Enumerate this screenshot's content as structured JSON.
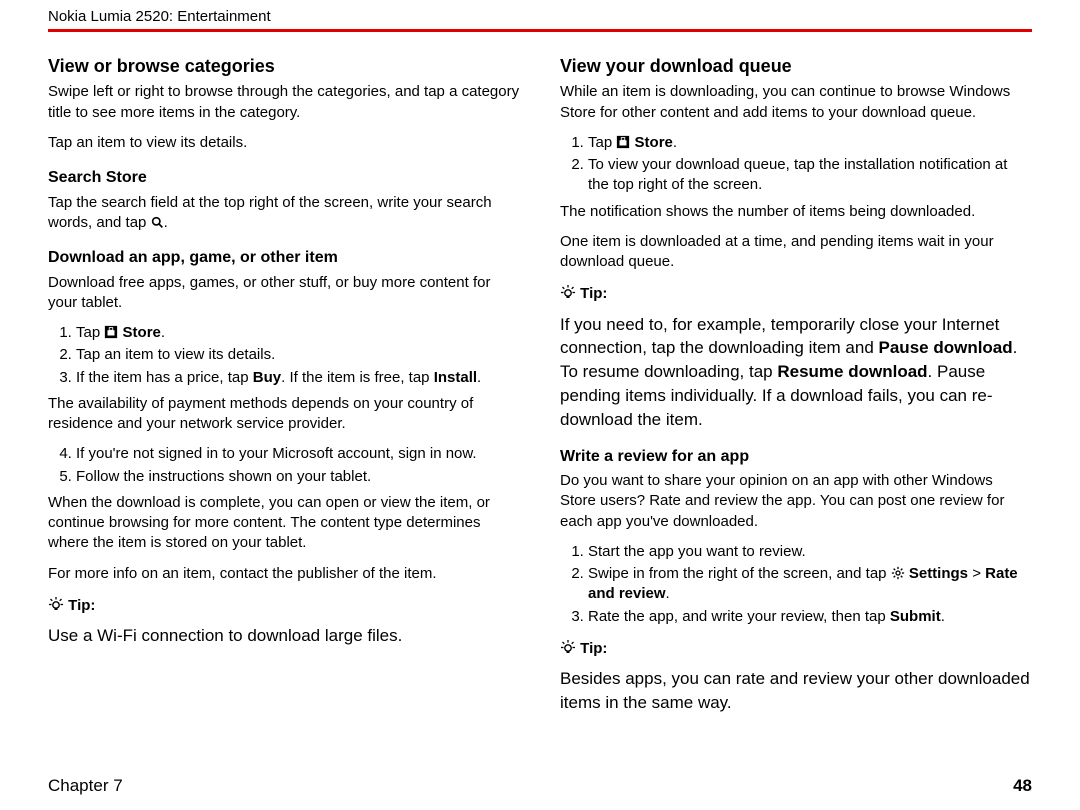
{
  "header": "Nokia Lumia 2520: Entertainment",
  "left": {
    "h_browse": "View or browse categories",
    "p_browse": "Swipe left or right to browse through the categories, and tap a category title to see more items in the category.",
    "p_tapitem": "Tap an item to view its details.",
    "h_search": "Search Store",
    "p_search_a": "Tap the search field at the top right of the screen, write your search words, and tap ",
    "p_search_b": ".",
    "h_download": "Download an app, game, or other item",
    "p_download": "Download free apps, games, or other stuff, or buy more content for your tablet.",
    "dl1_a": "Tap ",
    "dl1_b": "Store",
    "dl1_c": ".",
    "dl2": "Tap an item to view its details.",
    "dl3_a": "If the item has a price, tap ",
    "dl3_b": "Buy",
    "dl3_c": ". If the item is free, tap ",
    "dl3_d": "Install",
    "dl3_e": ".",
    "p_avail": "The availability of payment methods depends on your country of residence and your network service provider.",
    "dl4": "If you're not signed in to your Microsoft account, sign in now.",
    "dl5": "Follow the instructions shown on your tablet.",
    "p_done": "When the download is complete, you can open or view the item, or continue browsing for more content. The content type determines where the item is stored on your tablet.",
    "p_info": "For more info on an item, contact the publisher of the item.",
    "tip_label": "Tip:",
    "tip_body": "Use a Wi-Fi connection to download large files."
  },
  "right": {
    "h_queue": "View your download queue",
    "p_queue": "While an item is downloading, you can continue to browse Windows Store for other content and add items to your download queue.",
    "q1_a": "Tap ",
    "q1_b": "Store",
    "q1_c": ".",
    "q2": "To view your download queue, tap the installation notification at the top right of the screen.",
    "p_notif": "The notification shows the number of items being downloaded.",
    "p_one": "One item is downloaded at a time, and pending items wait in your download queue.",
    "tip1_label": "Tip:",
    "tip1_a": "If you need to, for example, temporarily close your Internet connection, tap the downloading item and ",
    "tip1_b": "Pause download",
    "tip1_c": ". To resume downloading, tap ",
    "tip1_d": "Resume download",
    "tip1_e": ". Pause pending items individually. If a download fails, you can re-download the item.",
    "h_review": "Write a review for an app",
    "p_review": "Do you want to share your opinion on an app with other Windows Store users? Rate and review the app. You can post one review for each app you've downloaded.",
    "r1": "Start the app you want to review.",
    "r2_a": "Swipe in from the right of the screen, and tap ",
    "r2_b": "Settings",
    "r2_c": " > ",
    "r2_d": "Rate and review",
    "r2_e": ".",
    "r3_a": "Rate the app, and write your review, then tap ",
    "r3_b": "Submit",
    "r3_c": ".",
    "tip2_label": "Tip:",
    "tip2_body": "Besides apps, you can rate and review your other downloaded items in the same way."
  },
  "footer": {
    "chapter": "Chapter 7",
    "page": "48"
  }
}
